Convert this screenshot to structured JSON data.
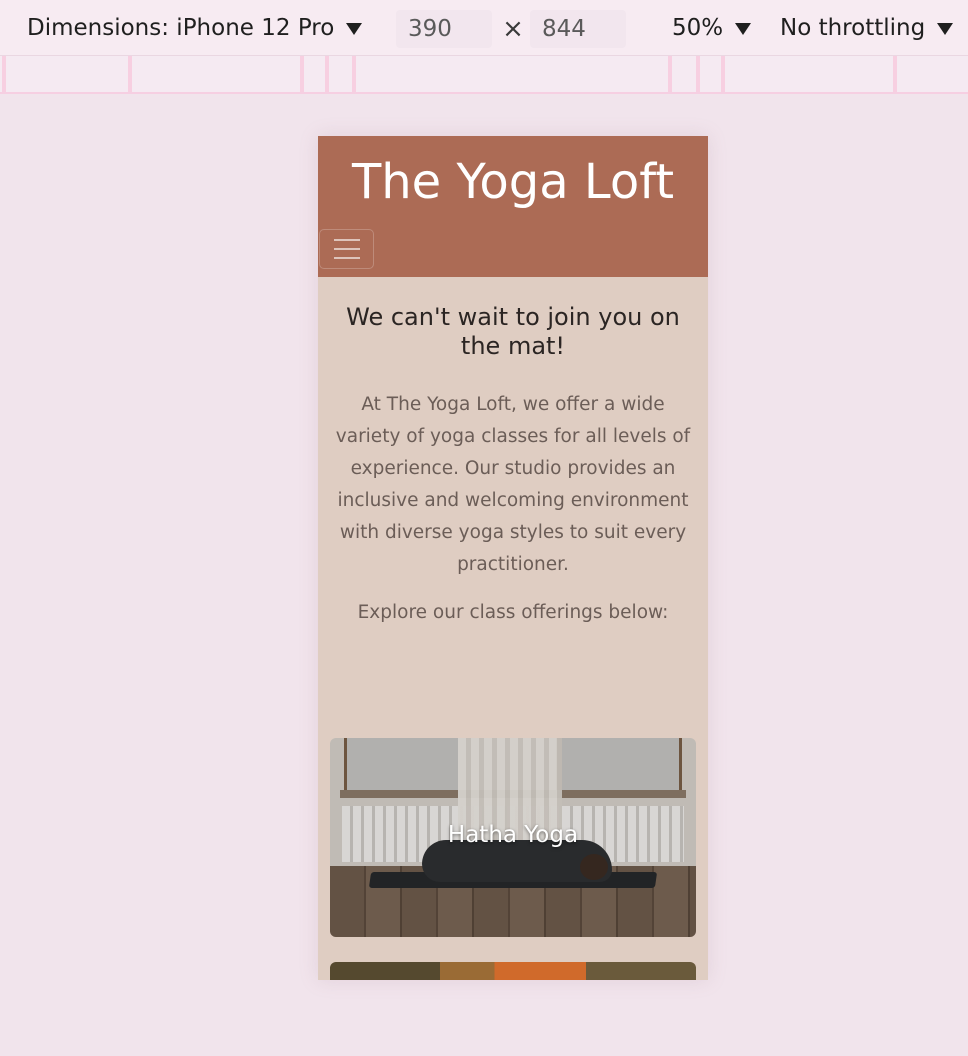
{
  "devtools": {
    "device_label": "Dimensions: iPhone 12 Pro",
    "width": "390",
    "height": "844",
    "times_symbol": "×",
    "zoom": "50%",
    "throttling": "No throttling"
  },
  "site": {
    "title": "The Yoga Loft",
    "menu_icon": "hamburger-menu-icon",
    "header_color": "#ac6b55",
    "background_color": "#dfcdc2"
  },
  "intro": {
    "heading": "We can't wait to join you on the mat!",
    "body": "At The Yoga Loft, we offer a wide variety of yoga classes for all levels of experience. Our studio provides an inclusive and welcoming environment with diverse yoga styles to suit every practitioner.",
    "explore": "Explore our class offerings below:"
  },
  "classes": [
    {
      "label": "Hatha Yoga"
    },
    {
      "label": ""
    }
  ]
}
